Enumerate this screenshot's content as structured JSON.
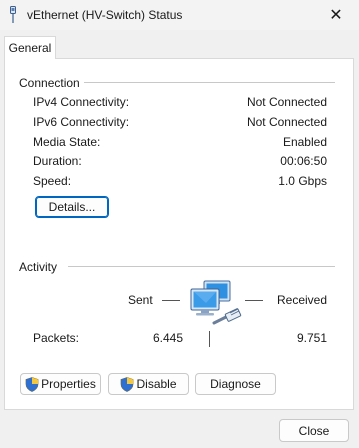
{
  "window": {
    "title": "vEthernet (HV-Switch) Status",
    "close_glyph": "✕"
  },
  "tabs": [
    {
      "label": "General",
      "selected": true
    }
  ],
  "connection": {
    "heading": "Connection",
    "rows": [
      {
        "label": "IPv4 Connectivity:",
        "value": "Not Connected"
      },
      {
        "label": "IPv6 Connectivity:",
        "value": "Not Connected"
      },
      {
        "label": "Media State:",
        "value": "Enabled"
      },
      {
        "label": "Duration:",
        "value": "00:06:50"
      },
      {
        "label": "Speed:",
        "value": "1.0 Gbps"
      }
    ],
    "details_button": "Details..."
  },
  "activity": {
    "heading": "Activity",
    "sent_label": "Sent",
    "received_label": "Received",
    "packets_label": "Packets:",
    "packets_sent": "6.445",
    "packets_received": "9.751",
    "icon": "network-computers-icon"
  },
  "actions": {
    "properties": "Properties",
    "disable": "Disable",
    "diagnose": "Diagnose"
  },
  "footer": {
    "close": "Close"
  },
  "colors": {
    "accent": "#0067c0",
    "panel_bg": "#ffffff",
    "window_bg": "#f0f0f0"
  }
}
